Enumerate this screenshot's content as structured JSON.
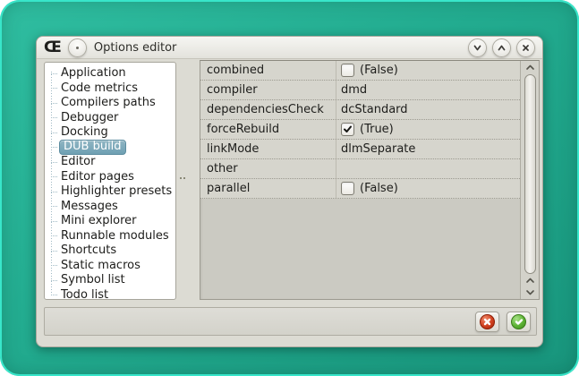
{
  "colors": {
    "backdrop_teal": "#1fa387",
    "backdrop_rim": "#38e6ca",
    "window_gray": "#dcdbd3",
    "selection_blue": "#76a5b6",
    "cancel_red": "#c23318",
    "accept_green": "#58b033"
  },
  "window": {
    "title": "Options editor",
    "app_icon_glyph": "Œ",
    "titlebar_icons": [
      "window-menu-icon",
      "minimize-icon (chevron-down)",
      "maximize-icon (chevron-up)",
      "close-icon (x)"
    ]
  },
  "sidebar": {
    "items": [
      {
        "label": "Application",
        "selected": false
      },
      {
        "label": "Code metrics",
        "selected": false
      },
      {
        "label": "Compilers paths",
        "selected": false
      },
      {
        "label": "Debugger",
        "selected": false
      },
      {
        "label": "Docking",
        "selected": false
      },
      {
        "label": "DUB build",
        "selected": true
      },
      {
        "label": "Editor",
        "selected": false
      },
      {
        "label": "Editor pages",
        "selected": false
      },
      {
        "label": "Highlighter presets",
        "selected": false
      },
      {
        "label": "Messages",
        "selected": false
      },
      {
        "label": "Mini explorer",
        "selected": false
      },
      {
        "label": "Runnable modules",
        "selected": false
      },
      {
        "label": "Shortcuts",
        "selected": false
      },
      {
        "label": "Static macros",
        "selected": false
      },
      {
        "label": "Symbol list",
        "selected": false
      },
      {
        "label": "Todo list",
        "selected": false
      }
    ]
  },
  "property_grid": {
    "rows": [
      {
        "name": "combined",
        "editor": "checkbox",
        "checked": false,
        "value": "(False)"
      },
      {
        "name": "compiler",
        "editor": "text",
        "value": "dmd"
      },
      {
        "name": "dependenciesCheck",
        "editor": "text",
        "value": "dcStandard"
      },
      {
        "name": "forceRebuild",
        "editor": "checkbox",
        "checked": true,
        "value": "(True)"
      },
      {
        "name": "linkMode",
        "editor": "text",
        "value": "dlmSeparate"
      },
      {
        "name": "other",
        "editor": "text",
        "value": ""
      },
      {
        "name": "parallel",
        "editor": "checkbox",
        "checked": false,
        "value": "(False)"
      }
    ]
  },
  "footer": {
    "buttons": [
      {
        "name": "cancel",
        "icon": "cancel-x-icon"
      },
      {
        "name": "accept",
        "icon": "accept-check-icon"
      }
    ]
  }
}
